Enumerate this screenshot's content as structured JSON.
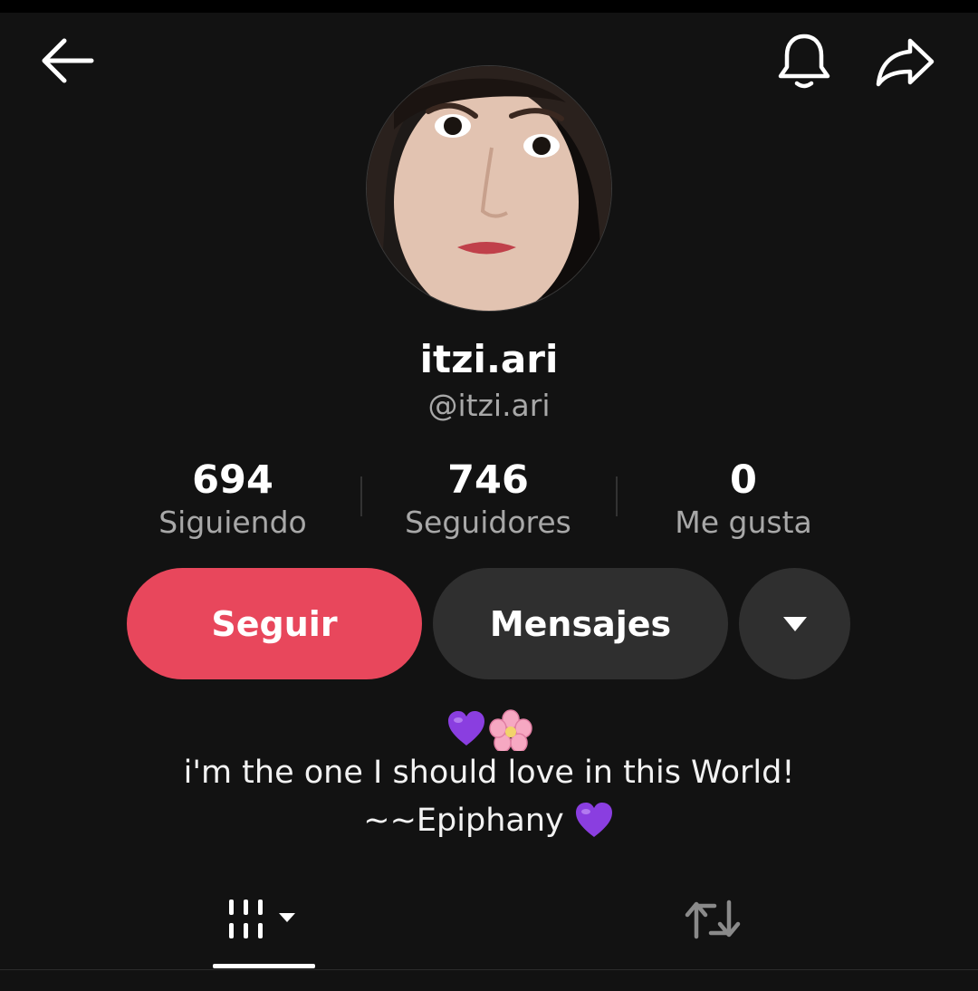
{
  "header": {
    "back_icon": "arrow-left-icon",
    "notifications_icon": "bell-icon",
    "share_icon": "share-arrow-icon"
  },
  "profile": {
    "display_name": "itzi.ari",
    "handle": "@itzi.ari",
    "avatar": "profile-photo"
  },
  "stats": [
    {
      "value": "694",
      "label": "Siguiendo"
    },
    {
      "value": "746",
      "label": "Seguidores"
    },
    {
      "value": "0",
      "label": "Me gusta"
    }
  ],
  "actions": {
    "follow_label": "Seguir",
    "message_label": "Mensajes",
    "more_icon": "caret-down-icon"
  },
  "bio": {
    "emoji_line": [
      "purple-heart-emoji",
      "cherry-blossom-emoji"
    ],
    "line1": "i'm the one I should love in this World!",
    "line2": "~~Epiphany",
    "line2_emoji": "purple-heart-emoji"
  },
  "tabs": [
    {
      "icon": "videos-grid-icon",
      "selected": true
    },
    {
      "icon": "repost-icon",
      "selected": false
    }
  ],
  "colors": {
    "background": "#121212",
    "follow_button": "#e8475c",
    "secondary_button": "#2f2f2f",
    "muted_text": "#a8a8a8"
  }
}
